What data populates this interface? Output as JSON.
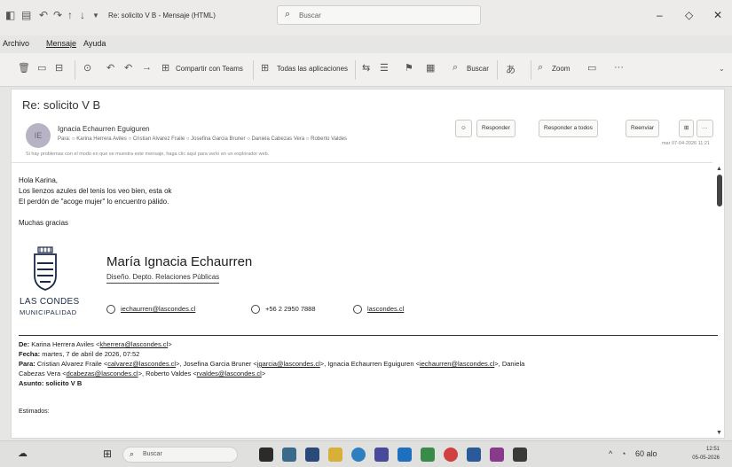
{
  "titlebar": {
    "title": "Re: solicito V B - Mensaje (HTML)",
    "search_placeholder": "Buscar",
    "minimize": "–",
    "restore": "◇",
    "close": "✕"
  },
  "menu": {
    "archivo": "Archivo",
    "mensaje": "Mensaje",
    "ayuda": "Ayuda"
  },
  "ribbon": {
    "share_teams": "Compartir con Teams",
    "all_apps": "Todas las aplicaciones",
    "search": "Buscar",
    "zoom": "Zoom",
    "more": "···"
  },
  "message": {
    "subject": "Re: solicito V B",
    "avatar_initials": "IE",
    "sender": "Ignacia Echaurren Eguiguren",
    "recipients": "Para: ○ Karina Herrera Aviles  ○ Cristian Alvarez Fraile  ○ Josefina Garcia Bruner  ○ Daniela Cabezas Vera  ○ Roberto Valdes",
    "info": "Si hay problemas con el modo en que se muestra este mensaje, haga clic aquí para verlo en un explorador web.",
    "datetime": "mar 07-04-2026 11:21",
    "actions": {
      "emoji": "☺",
      "reply": "Responder",
      "reply_all": "Responder a todos",
      "forward": "Reenviar",
      "teams": "⊞",
      "more": "···"
    }
  },
  "body": {
    "line1": "Hola Karina,",
    "line2": "Los lienzos azules del tenis los veo bien, esta ok",
    "line3": "El perdón de \"acoge mujer\" lo encuentro pálido.",
    "line4": "Muchas gracias"
  },
  "signature": {
    "logo_text": "LAS CONDES",
    "logo_sub": "MUNICIPALIDAD",
    "name": "María Ignacia Echaurren",
    "role": "Diseño. Depto. Relaciones Públicas",
    "email": "iechaurren@lascondes.cl",
    "phone": "+56 2 2950 7888",
    "web": "lascondes.cl"
  },
  "quoted": {
    "de_label": "De:",
    "de_value": "Karina Herrera Aviles <",
    "de_email": "kherrera@lascondes.cl",
    "de_end": ">",
    "fecha_label": "Fecha:",
    "fecha_value": "martes, 7 de abril de 2026, 07:52",
    "para_label": "Para:",
    "para_1": "Cristian Alvarez Fraile <",
    "para_1_email": "calvarez@lascondes.cl",
    "para_2": ">, Josefina Garcia Bruner <",
    "para_2_email": "jgarcia@lascondes.cl",
    "para_3": ">, Ignacia Echaurren Eguiguren <",
    "para_3_email": "iechaurren@lascondes.cl",
    "para_4": ">, Daniela",
    "para_5": "Cabezas Vera <",
    "para_5_email": "dcabezas@lascondes.cl",
    "para_6": ">, Roberto Valdes <",
    "para_6_email": "rvaldes@lascondes.cl",
    "para_7": ">",
    "asunto_label": "Asunto:",
    "asunto_value": "solicito V B",
    "estimados": "Estimados:"
  },
  "taskbar": {
    "search_placeholder": "Buscar",
    "weather": "60 alo",
    "time": "12:51",
    "date": "05-05-2026"
  },
  "colors": {
    "pane_bg": "#ffffff",
    "chrome_bg": "#ecebe9",
    "avatar": "#b8b3c4",
    "logo_blue": "#1a2a4a"
  }
}
